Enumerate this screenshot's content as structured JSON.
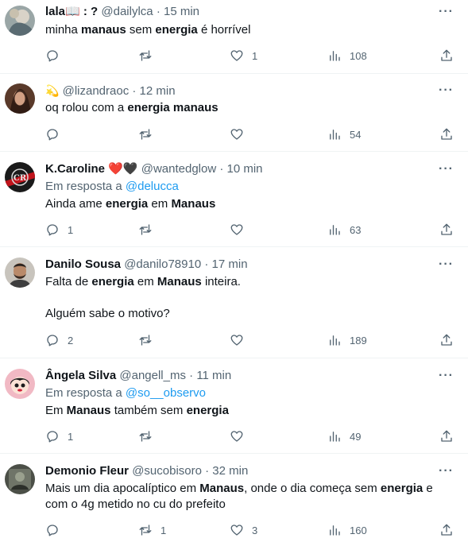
{
  "tweets": [
    {
      "name": "lala📖 : ?",
      "handle": "@dailylca",
      "time": "· 15 min",
      "reply_prefix": "",
      "reply_to": "",
      "body": [
        [
          [
            "minha ",
            false
          ],
          [
            "manaus",
            true
          ],
          [
            " sem ",
            false
          ],
          [
            "energia",
            true
          ],
          [
            " é horrível",
            false
          ]
        ]
      ],
      "replies": "",
      "retweets": "",
      "likes": "1",
      "views": "108"
    },
    {
      "name": "💫",
      "handle": "@lizandraoc",
      "time": "· 12 min",
      "reply_prefix": "",
      "reply_to": "",
      "body": [
        [
          [
            "oq rolou com a ",
            false
          ],
          [
            "energia manaus",
            true
          ]
        ]
      ],
      "replies": "",
      "retweets": "",
      "likes": "",
      "views": "54"
    },
    {
      "name": "K.Caroline ❤️🖤",
      "handle": "@wantedglow",
      "time": "· 10 min",
      "reply_prefix": "Em resposta a",
      "reply_to": "@delucca",
      "body": [
        [
          [
            "Ainda ame ",
            false
          ],
          [
            "energia",
            true
          ],
          [
            " em ",
            false
          ],
          [
            "Manaus",
            true
          ]
        ]
      ],
      "replies": "1",
      "retweets": "",
      "likes": "",
      "views": "63"
    },
    {
      "name": "Danilo Sousa",
      "handle": "@danilo78910",
      "time": "· 17 min",
      "reply_prefix": "",
      "reply_to": "",
      "body": [
        [
          [
            "Falta de ",
            false
          ],
          [
            "energia",
            true
          ],
          [
            " em ",
            false
          ],
          [
            "Manaus",
            true
          ],
          [
            " inteira.",
            false
          ]
        ],
        [
          [
            "Alguém sabe o motivo?",
            false
          ]
        ]
      ],
      "replies": "2",
      "retweets": "",
      "likes": "",
      "views": "189"
    },
    {
      "name": "Ângela Silva",
      "handle": "@angell_ms",
      "time": "· 11 min",
      "reply_prefix": "Em resposta a",
      "reply_to": "@so__observo",
      "body": [
        [
          [
            "Em ",
            false
          ],
          [
            "Manaus",
            true
          ],
          [
            " também sem ",
            false
          ],
          [
            "energia",
            true
          ]
        ]
      ],
      "replies": "1",
      "retweets": "",
      "likes": "",
      "views": "49"
    },
    {
      "name": "Demonio Fleur",
      "handle": "@sucobisoro",
      "time": "· 32 min",
      "reply_prefix": "",
      "reply_to": "",
      "body": [
        [
          [
            "Mais um dia apocalíptico em ",
            false
          ],
          [
            "Manaus",
            true
          ],
          [
            ", onde o dia começa sem ",
            false
          ],
          [
            "energia",
            true
          ],
          [
            " e",
            false
          ]
        ],
        [
          [
            "com o 4g metido no cu do prefeito",
            false
          ]
        ]
      ],
      "replies": "",
      "retweets": "1",
      "likes": "3",
      "views": "160"
    }
  ],
  "more_label": "···"
}
